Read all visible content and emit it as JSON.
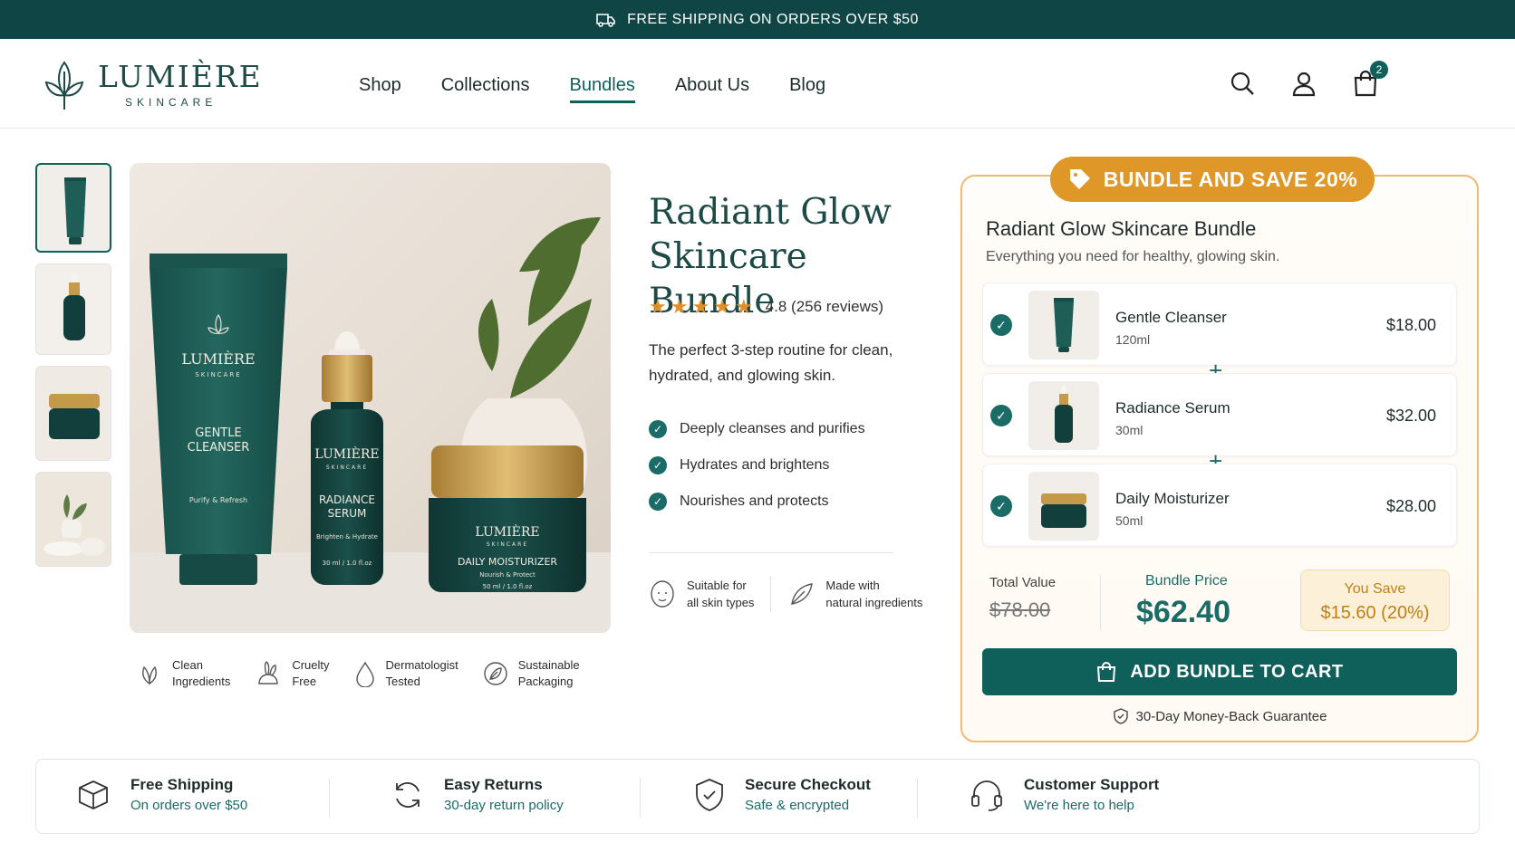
{
  "topbar": {
    "text": "FREE SHIPPING ON ORDERS OVER $50",
    "icon": "truck-icon"
  },
  "brand": {
    "name": "LUMIÈRE",
    "sub": "SKINCARE"
  },
  "nav": {
    "items": [
      {
        "label": "Shop"
      },
      {
        "label": "Collections"
      },
      {
        "label": "Bundles",
        "active": true
      },
      {
        "label": "About Us"
      },
      {
        "label": "Blog"
      }
    ]
  },
  "header": {
    "cart_count": "2"
  },
  "product": {
    "title_line1": "Radiant Glow",
    "title_line2": "Skincare Bundle",
    "rating": 4.8,
    "rating_text": "4.8 (256 reviews)",
    "description": "The perfect 3-step routine for clean, hydrated, and glowing skin.",
    "features": [
      "Deeply cleanses and purifies",
      "Hydrates and brightens",
      "Nourishes and protects"
    ],
    "extras": [
      {
        "line1": "Suitable for",
        "line2": "all skin types"
      },
      {
        "line1": "Made with",
        "line2": "natural ingredients"
      }
    ]
  },
  "hero_labels": {
    "brand": "LUMIÈRE",
    "brand_sub": "SKINCARE",
    "tube_l1": "GENTLE",
    "tube_l2": "CLEANSER",
    "tube_tag": "Purify & Refresh",
    "serum_l1": "RADIANCE",
    "serum_l2": "SERUM",
    "serum_tag": "Brighten & Hydrate",
    "serum_vol": "30 ml / 1.0 fl.oz",
    "jar_l1": "DAILY MOISTURIZER",
    "jar_tag": "Nourish & Protect",
    "jar_vol": "50 ml / 1.0 fl.oz"
  },
  "badges": [
    {
      "line1": "Clean",
      "line2": "Ingredients"
    },
    {
      "line1": "Cruelty",
      "line2": "Free"
    },
    {
      "line1": "Dermatologist",
      "line2": "Tested"
    },
    {
      "line1": "Sustainable",
      "line2": "Packaging"
    }
  ],
  "bundle": {
    "pill": "BUNDLE AND SAVE 20%",
    "title": "Radiant Glow Skincare Bundle",
    "subtitle": "Everything you need for healthy, glowing skin.",
    "items": [
      {
        "name": "Gentle Cleanser",
        "size": "120ml",
        "price": "$18.00"
      },
      {
        "name": "Radiance Serum",
        "size": "30ml",
        "price": "$32.00"
      },
      {
        "name": "Daily Moisturizer",
        "size": "50ml",
        "price": "$28.00"
      }
    ],
    "total_label": "Total Value",
    "total_value": "$78.00",
    "price_label": "Bundle Price",
    "price_value": "$62.40",
    "save_label": "You Save",
    "save_value": "$15.60 (20%)",
    "cta": "ADD BUNDLE TO CART",
    "guarantee": "30-Day Money-Back Guarantee"
  },
  "footer": [
    {
      "title": "Free Shipping",
      "sub": "On orders over $50",
      "icon": "box-icon"
    },
    {
      "title": "Easy Returns",
      "sub": "30-day return policy",
      "icon": "refresh-icon"
    },
    {
      "title": "Secure Checkout",
      "sub": "Safe & encrypted",
      "icon": "shield-icon"
    },
    {
      "title": "Customer Support",
      "sub": "We're here to help",
      "icon": "headset-icon"
    }
  ],
  "colors": {
    "primary": "#0f5f5b",
    "accent": "#df9727",
    "topbar": "#0f4645"
  }
}
